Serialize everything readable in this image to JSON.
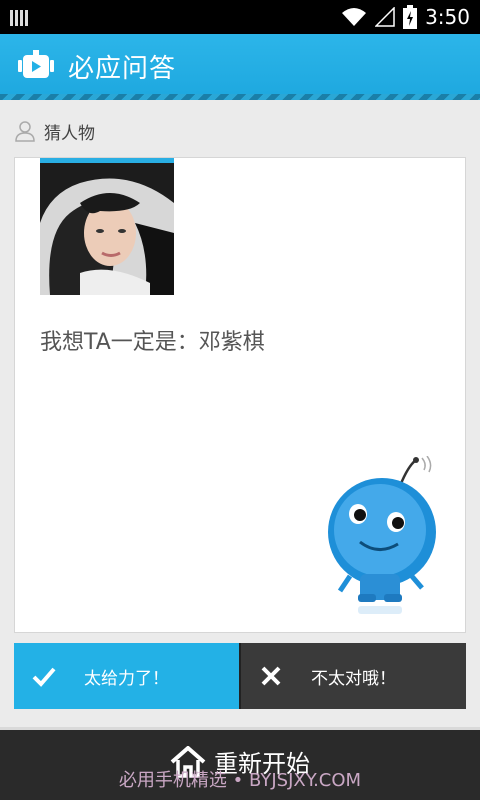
{
  "status_bar": {
    "time": "3:50"
  },
  "header": {
    "title": "必应问答",
    "logo_icon": "robot-tv-icon",
    "accent": "#23b1e6"
  },
  "section": {
    "label": "猜人物",
    "icon": "person-icon"
  },
  "card": {
    "answer": "我想TA一定是：邓紫棋",
    "photo_icon": "portrait-photo",
    "mascot_icon": "blue-robot-mascot"
  },
  "buttons": {
    "yes_label": "太给力了！",
    "yes_icon": "checkmark-icon",
    "no_label": "不太对哦！",
    "no_icon": "close-icon"
  },
  "bottom": {
    "restart_label": "重新开始",
    "restart_icon": "home-icon"
  },
  "watermark": "必用手机精选 • BYJSJXY.COM"
}
